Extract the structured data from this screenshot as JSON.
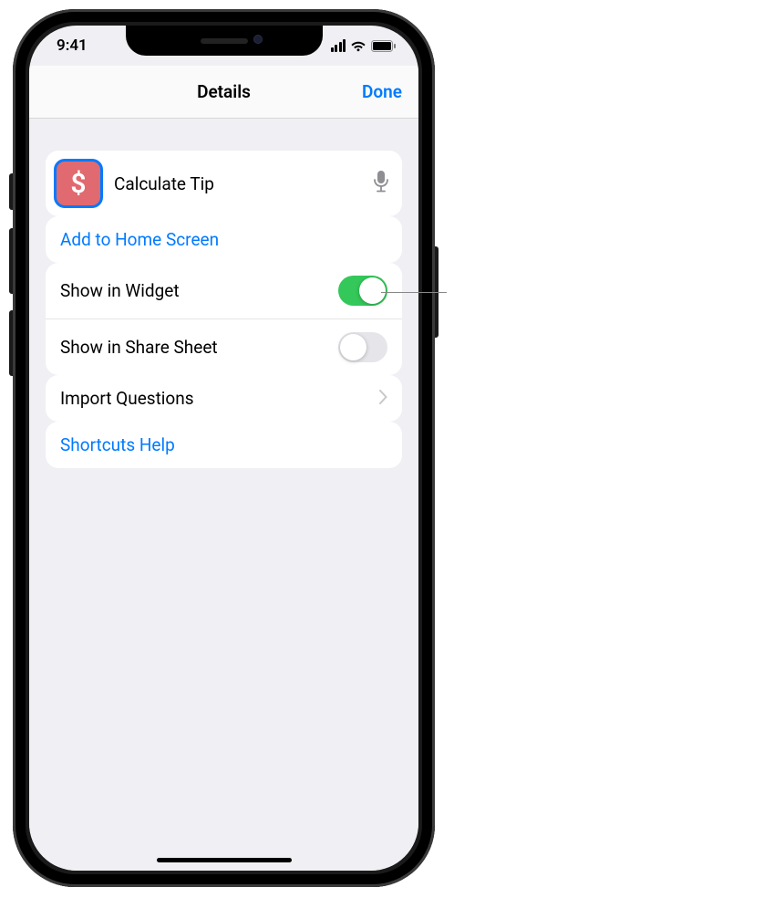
{
  "status": {
    "time": "9:41"
  },
  "nav": {
    "title": "Details",
    "done": "Done"
  },
  "shortcut": {
    "icon_glyph": "$",
    "name": "Calculate Tip",
    "icon_semantic": "dollar-icon"
  },
  "rows": {
    "add_home": "Add to Home Screen",
    "show_widget": "Show in Widget",
    "show_share": "Show in Share Sheet",
    "import_questions": "Import Questions",
    "help": "Shortcuts Help"
  },
  "toggles": {
    "show_widget": true,
    "show_share": false
  }
}
